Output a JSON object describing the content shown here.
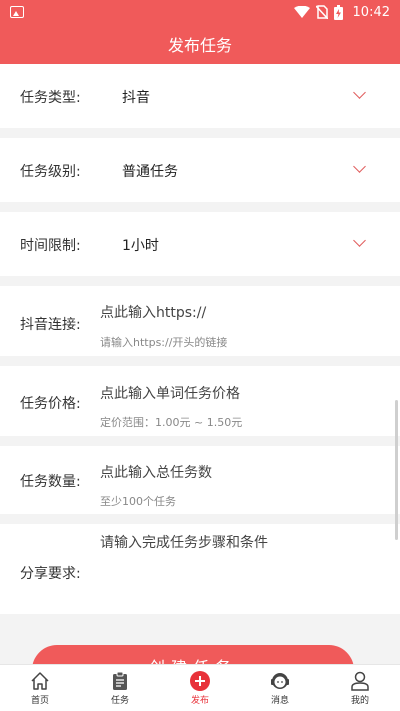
{
  "status_bar": {
    "time": "10:42"
  },
  "header": {
    "title": "发布任务"
  },
  "form": {
    "task_type": {
      "label": "任务类型:",
      "value": "抖音"
    },
    "task_level": {
      "label": "任务级别:",
      "value": "普通任务"
    },
    "time_limit": {
      "label": "时间限制:",
      "value": "1小时"
    },
    "douyin_link": {
      "label": "抖音连接:",
      "placeholder": "点此输入https://",
      "hint": "请输入https://开头的链接"
    },
    "task_price": {
      "label": "任务价格:",
      "placeholder": "点此输入单词任务价格",
      "hint": "定价范围：1.00元 ~ 1.50元"
    },
    "task_count": {
      "label": "任务数量:",
      "placeholder": "点此输入总任务数",
      "hint": "至少100个任务"
    },
    "share_requirement": {
      "label": "分享要求:",
      "placeholder": "请输入完成任务步骤和条件"
    }
  },
  "create_button": {
    "label": "创建任务"
  },
  "tabs": [
    {
      "label": "首页",
      "icon": "home-icon"
    },
    {
      "label": "任务",
      "icon": "clipboard-icon"
    },
    {
      "label": "发布",
      "icon": "plus-circle-icon",
      "active": true
    },
    {
      "label": "消息",
      "icon": "headset-icon"
    },
    {
      "label": "我的",
      "icon": "user-icon"
    }
  ],
  "colors": {
    "accent": "#f05a5a",
    "active_tab": "#e8323a"
  }
}
